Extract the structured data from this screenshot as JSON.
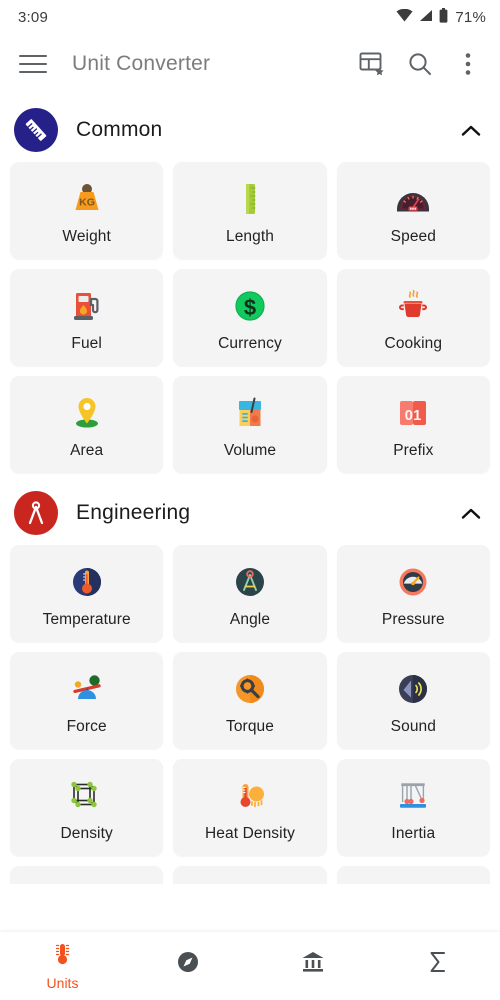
{
  "status_bar": {
    "time": "3:09",
    "battery_percent": "71%",
    "icons": [
      "wifi-icon",
      "signal-icon",
      "battery-icon"
    ]
  },
  "app_bar": {
    "menu_icon": "hamburger-menu-icon",
    "title": "Unit Converter",
    "actions": [
      {
        "name": "custom-grid-favorite-icon"
      },
      {
        "name": "search-icon"
      },
      {
        "name": "overflow-menu-icon"
      }
    ]
  },
  "colors": {
    "common_avatar": "#252188",
    "engineering_avatar": "#C8261F",
    "card_bg": "#F4F4F4",
    "accent": "#F4511E",
    "title_text": "#7A7D80"
  },
  "sections": [
    {
      "title": "Common",
      "avatar_icon": "ruler-icon",
      "avatar_color": "#252188",
      "expanded": true,
      "chevron": "chevron-up-icon",
      "items": [
        {
          "label": "Weight",
          "icon": "weight-kg-icon"
        },
        {
          "label": "Length",
          "icon": "ruler-length-icon"
        },
        {
          "label": "Speed",
          "icon": "speedometer-icon"
        },
        {
          "label": "Fuel",
          "icon": "fuel-pump-icon"
        },
        {
          "label": "Currency",
          "icon": "dollar-coin-icon"
        },
        {
          "label": "Cooking",
          "icon": "cooking-pot-icon"
        },
        {
          "label": "Area",
          "icon": "map-pin-icon"
        },
        {
          "label": "Volume",
          "icon": "beaker-icon"
        },
        {
          "label": "Prefix",
          "icon": "number-card-01-icon"
        }
      ]
    },
    {
      "title": "Engineering",
      "avatar_icon": "drafting-compass-icon",
      "avatar_color": "#C8261F",
      "expanded": true,
      "chevron": "chevron-up-icon",
      "items": [
        {
          "label": "Temperature",
          "icon": "thermometer-circle-icon"
        },
        {
          "label": "Angle",
          "icon": "compass-circle-icon"
        },
        {
          "label": "Pressure",
          "icon": "pressure-gauge-icon"
        },
        {
          "label": "Force",
          "icon": "seesaw-icon"
        },
        {
          "label": "Torque",
          "icon": "wrench-circle-icon"
        },
        {
          "label": "Sound",
          "icon": "speaker-icon"
        },
        {
          "label": "Density",
          "icon": "cube-lattice-icon"
        },
        {
          "label": "Heat Density",
          "icon": "thermometer-sun-icon"
        },
        {
          "label": "Inertia",
          "icon": "newtons-cradle-icon"
        }
      ]
    }
  ],
  "bottom_nav": {
    "items": [
      {
        "label": "Units",
        "icon": "thermometer-icon",
        "active": true
      },
      {
        "label": "",
        "icon": "compass-icon",
        "active": false
      },
      {
        "label": "",
        "icon": "bank-icon",
        "active": false
      },
      {
        "label": "",
        "icon": "sigma-icon",
        "active": false
      }
    ]
  }
}
